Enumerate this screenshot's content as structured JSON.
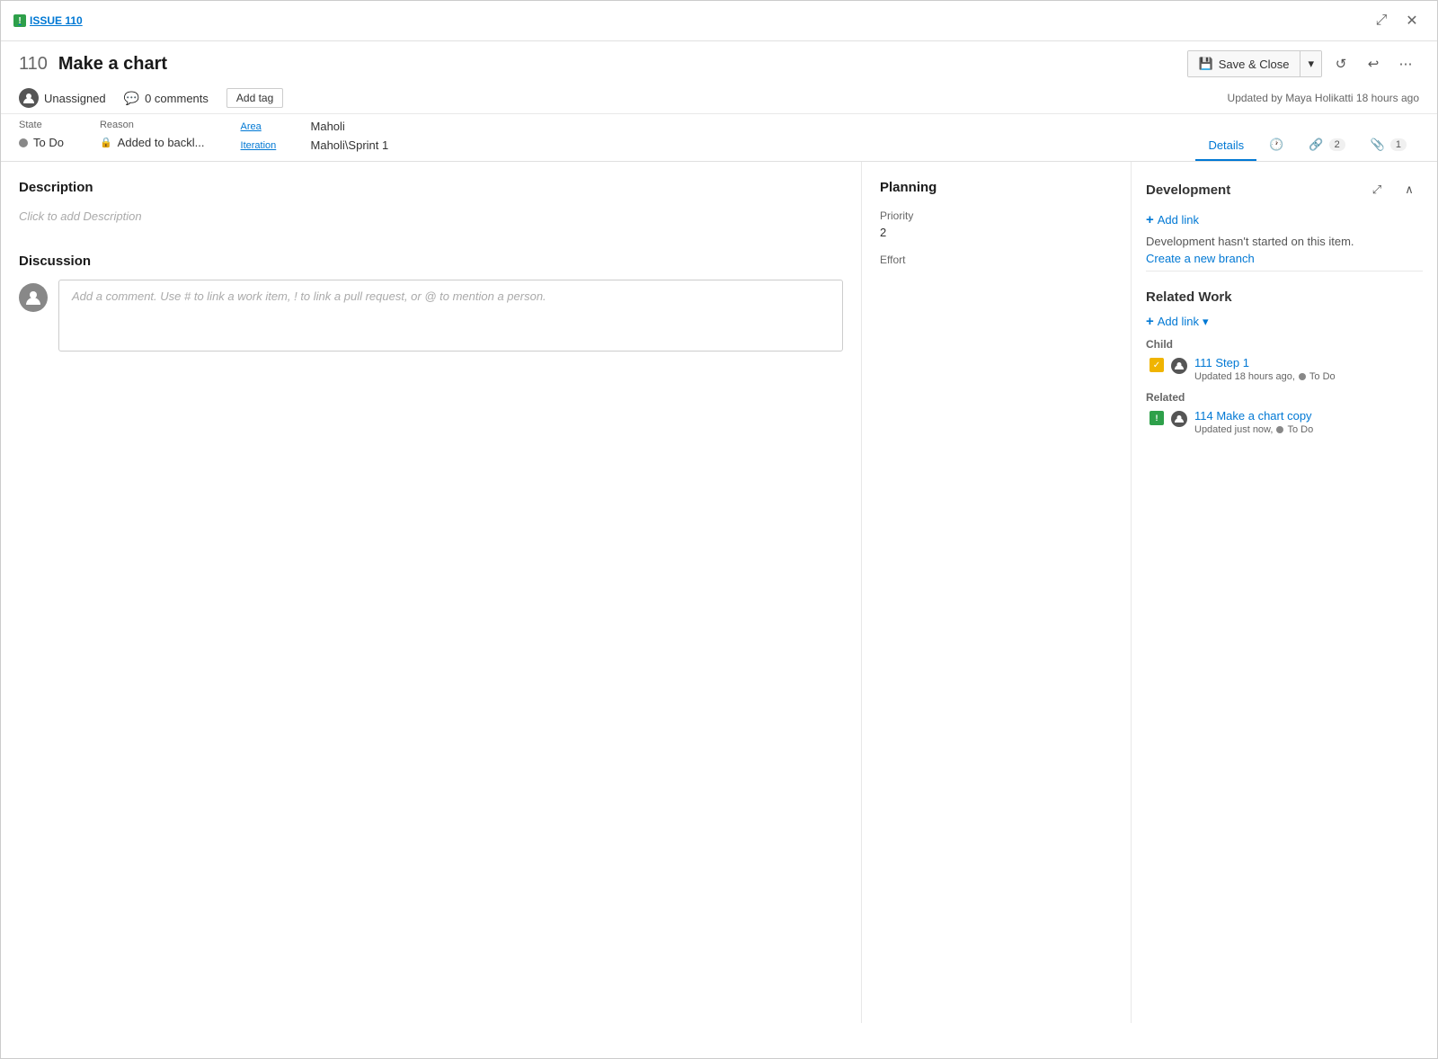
{
  "window": {
    "title": "ISSUE 110"
  },
  "header": {
    "issue_tag": "ISSUE 110",
    "work_item_number": "110",
    "work_item_title": "Make a chart",
    "save_close_label": "Save & Close",
    "updated_by": "Updated by Maya Holikatti 18 hours ago"
  },
  "meta": {
    "assignee": "Unassigned",
    "comments_count": "0 comments",
    "add_tag_label": "Add tag"
  },
  "state": {
    "state_label": "State",
    "state_value": "To Do",
    "reason_label": "Reason",
    "reason_value": "Added to backl...",
    "area_label": "Area",
    "area_value": "Maholi",
    "iteration_label": "Iteration",
    "iteration_value": "Maholi\\Sprint 1"
  },
  "tabs": {
    "details": "Details",
    "history": "",
    "links": "2",
    "attachments": "1"
  },
  "description": {
    "title": "Description",
    "placeholder": "Click to add Description"
  },
  "discussion": {
    "title": "Discussion",
    "placeholder": "Add a comment. Use # to link a work item, ! to link a pull request, or @ to mention a person."
  },
  "planning": {
    "title": "Planning",
    "priority_label": "Priority",
    "priority_value": "2",
    "effort_label": "Effort",
    "effort_value": ""
  },
  "development": {
    "title": "Development",
    "add_link_label": "Add link",
    "dev_note": "Development hasn't started on this item.",
    "create_branch_label": "Create a new branch"
  },
  "related_work": {
    "title": "Related Work",
    "add_link_label": "Add link",
    "child_label": "Child",
    "child_items": [
      {
        "id": "111",
        "title": "Step 1",
        "updated": "Updated 18 hours ago,",
        "status": "To Do",
        "type": "checkbox"
      }
    ],
    "related_label": "Related",
    "related_items": [
      {
        "id": "114",
        "title": "Make a chart copy",
        "updated": "Updated just now,",
        "status": "To Do",
        "type": "issue"
      }
    ]
  },
  "icons": {
    "expand": "⤢",
    "close": "✕",
    "refresh": "↺",
    "undo": "↩",
    "more": "⋯",
    "chevron_down": "▾",
    "expand_section": "⤢",
    "collapse": "∧",
    "plus": "+"
  }
}
